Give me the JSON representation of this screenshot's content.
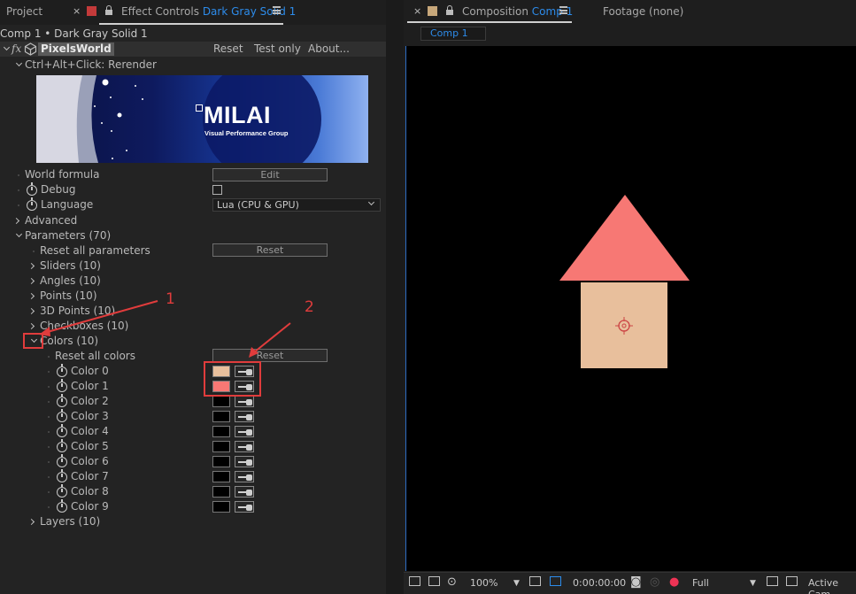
{
  "left_tabs": {
    "project": "Project",
    "effect_controls_prefix": "Effect Controls",
    "effect_controls_layer": "Dark Gray Solid 1"
  },
  "path_label": "Comp 1 • Dark Gray Solid 1",
  "effect": {
    "fx": "fx",
    "name": "PixelsWorld",
    "reset": "Reset",
    "test_only": "Test only",
    "about": "About..."
  },
  "rerender": "Ctrl+Alt+Click: Rerender",
  "banner": {
    "logo": "MILAI",
    "subtitle": "Visual Performance Group"
  },
  "world_formula": {
    "label": "World formula",
    "button": "Edit"
  },
  "debug": {
    "label": "Debug"
  },
  "language": {
    "label": "Language",
    "value": "Lua (CPU & GPU)"
  },
  "advanced": "Advanced",
  "parameters": "Parameters (70)",
  "reset_all_parameters": {
    "label": "Reset all parameters",
    "button": "Reset"
  },
  "groups": [
    "Sliders (10)",
    "Angles (10)",
    "Points (10)",
    "3D Points (10)",
    "Checkboxes (10)"
  ],
  "colors_group": "Colors (10)",
  "reset_all_colors": {
    "label": "Reset all colors",
    "button": "Reset"
  },
  "colors": [
    {
      "label": "Color 0",
      "value": "#e8bf9c"
    },
    {
      "label": "Color 1",
      "value": "#f77874"
    },
    {
      "label": "Color 2",
      "value": "#000000"
    },
    {
      "label": "Color 3",
      "value": "#000000"
    },
    {
      "label": "Color 4",
      "value": "#000000"
    },
    {
      "label": "Color 5",
      "value": "#000000"
    },
    {
      "label": "Color 6",
      "value": "#000000"
    },
    {
      "label": "Color 7",
      "value": "#000000"
    },
    {
      "label": "Color 8",
      "value": "#000000"
    },
    {
      "label": "Color 9",
      "value": "#000000"
    }
  ],
  "layers": "Layers (10)",
  "annotations": {
    "one": "1",
    "two": "2"
  },
  "right_tabs": {
    "composition_prefix": "Composition",
    "composition_name": "Comp 1",
    "footage": "Footage (none)",
    "comp_pill": "Comp 1"
  },
  "viewer": {
    "roof_color": "#f77874",
    "body_color": "#e8bf9c"
  },
  "bottom": {
    "zoom": "100%",
    "timecode": "0:00:00:00",
    "resolution": "Full",
    "camera": "Active Cam"
  }
}
